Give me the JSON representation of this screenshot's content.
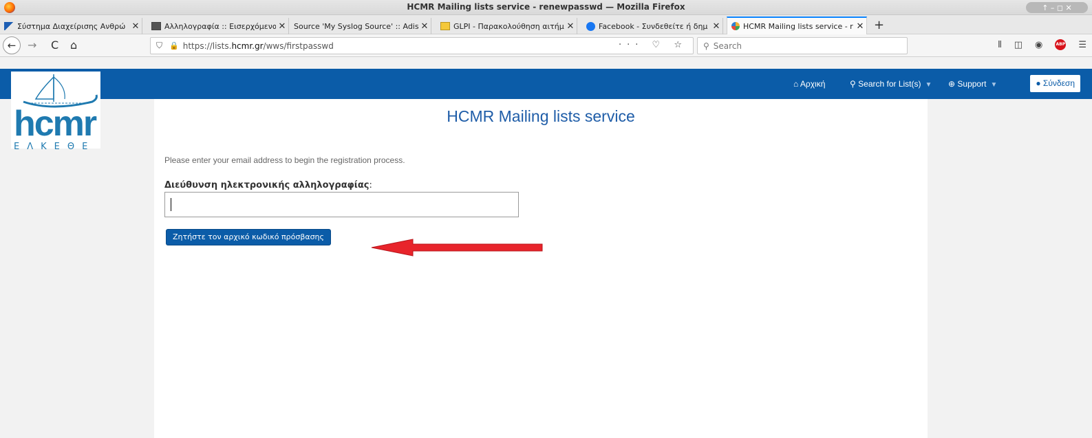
{
  "window": {
    "title": "HCMR Mailing lists service - renewpasswd — Mozilla Firefox",
    "controls": "↑ – ◻ ✕"
  },
  "tabs": [
    {
      "label": "Σύστημα Διαχείρισης Ανθρώ",
      "close": "✕",
      "icon": "blue-flag-icon"
    },
    {
      "label": "Αλληλογραφία :: Εισερχόμενα",
      "close": "✕",
      "icon": "mail-icon"
    },
    {
      "label": "Source 'My Syslog Source' :: Adis",
      "close": "✕",
      "icon": "none"
    },
    {
      "label": "GLPI - Παρακολούθηση αιτήμ",
      "close": "✕",
      "icon": "glpi-icon"
    },
    {
      "label": "Facebook - Συνδεθείτε ή δημ",
      "close": "✕",
      "icon": "facebook-icon"
    },
    {
      "label": "HCMR Mailing lists service - r",
      "close": "✕",
      "icon": "sympa-icon"
    }
  ],
  "newtab": "+",
  "nav": {
    "back": "←",
    "forward": "→",
    "reload": "C",
    "home": "⌂",
    "url_prefix": "https://lists.",
    "url_host": "hcmr.gr",
    "url_path": "/wws/firstpasswd",
    "url_actions": "··· ♡ ☆",
    "search_placeholder": "Search"
  },
  "site_nav": {
    "home": "Αρχική",
    "search_lists": "Search for List(s)",
    "support": "Support",
    "login": "Σύνδεση"
  },
  "logo": {
    "text": "hcmr",
    "sub": "ΕΛΚΕΘΕ"
  },
  "content": {
    "title": "HCMR Mailing lists service",
    "intro": "Please enter your email address to begin the registration process.",
    "email_label": "Διεύθυνση ηλεκτρονικής αλληλογραφίας",
    "email_colon": ":",
    "email_value": "",
    "submit": "Ζητήστε τον αρχικό κωδικό πρόσβασης"
  },
  "colors": {
    "brand": "#0b5ca8",
    "arrow": "#e8242b"
  }
}
